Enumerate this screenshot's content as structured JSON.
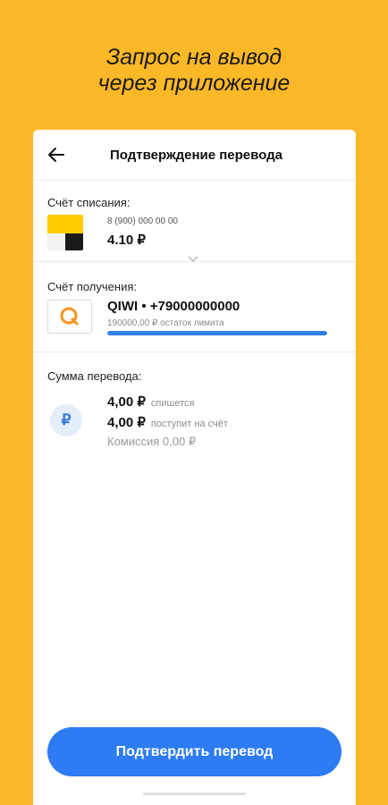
{
  "promo": {
    "line1": "Запрос на вывод",
    "line2": "через приложение"
  },
  "appbar": {
    "title": "Подтверждение перевода",
    "back_icon": "arrow-left-icon"
  },
  "source": {
    "label": "Счёт списания:",
    "phone": "8 (900) 000 00 00",
    "balance": "4.10 ₽",
    "icon": "yandex-money-icon"
  },
  "destination": {
    "label": "Счёт получения:",
    "name": "QIWI • +79000000000",
    "limit_text": "190000,00 ₽ остаток лимита",
    "limit_remaining_fraction": 1.0,
    "icon": "qiwi-icon",
    "accent_color": "#2F80ED"
  },
  "amount": {
    "label": "Сумма перевода:",
    "debit_value": "4,00 ₽",
    "debit_note": "спишется",
    "credit_value": "4,00 ₽",
    "credit_note": "поступит на счёт",
    "commission": "Комиссия 0,00 ₽",
    "icon": "ruble-icon",
    "icon_glyph": "₽"
  },
  "actions": {
    "confirm_label": "Подтвердить перевод"
  },
  "colors": {
    "background": "#FDB827",
    "button": "#2D7CF3"
  }
}
